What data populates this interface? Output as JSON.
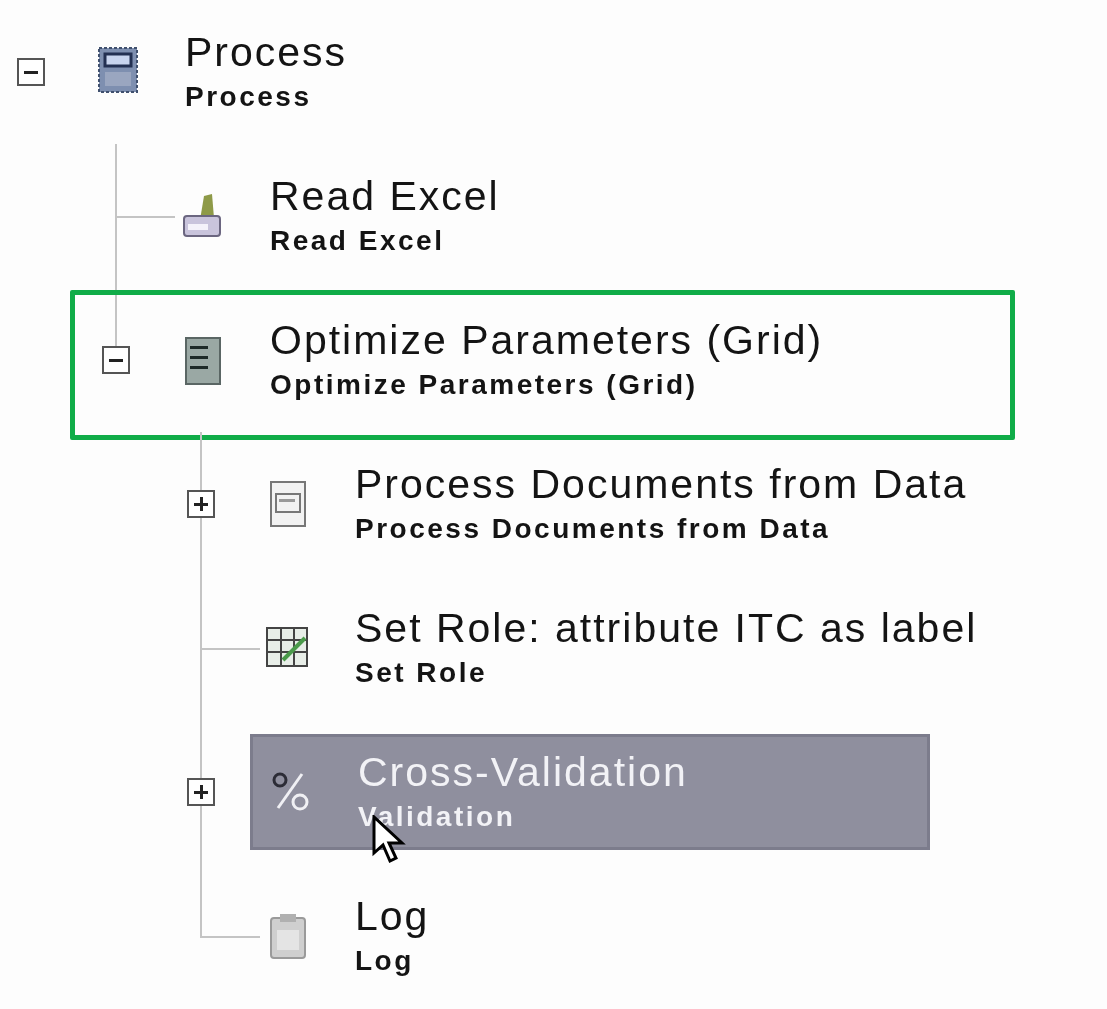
{
  "tree": [
    {
      "title": "Process",
      "subtitle": "Process",
      "kind": "process",
      "expanded": true,
      "selected": false,
      "outlined": false,
      "children": [
        {
          "title": "Read Excel",
          "subtitle": "Read Excel",
          "kind": "read-excel",
          "selected": false,
          "outlined": false
        },
        {
          "title": "Optimize Parameters (Grid)",
          "subtitle": "Optimize Parameters (Grid)",
          "kind": "optimize",
          "expanded": true,
          "selected": false,
          "outlined": true,
          "children": [
            {
              "title": "Process Documents from Data",
              "subtitle": "Process Documents from Data",
              "kind": "documents",
              "expanded": false,
              "selected": false,
              "outlined": false
            },
            {
              "title": "Set Role: attribute ITC as label",
              "subtitle": "Set Role",
              "kind": "set-role",
              "selected": false,
              "outlined": false
            },
            {
              "title": "Cross-Validation",
              "subtitle": "Validation",
              "kind": "validation",
              "expanded": false,
              "selected": true,
              "outlined": false
            },
            {
              "title": "Log",
              "subtitle": "Log",
              "kind": "log",
              "selected": false,
              "outlined": false
            }
          ]
        }
      ]
    }
  ]
}
